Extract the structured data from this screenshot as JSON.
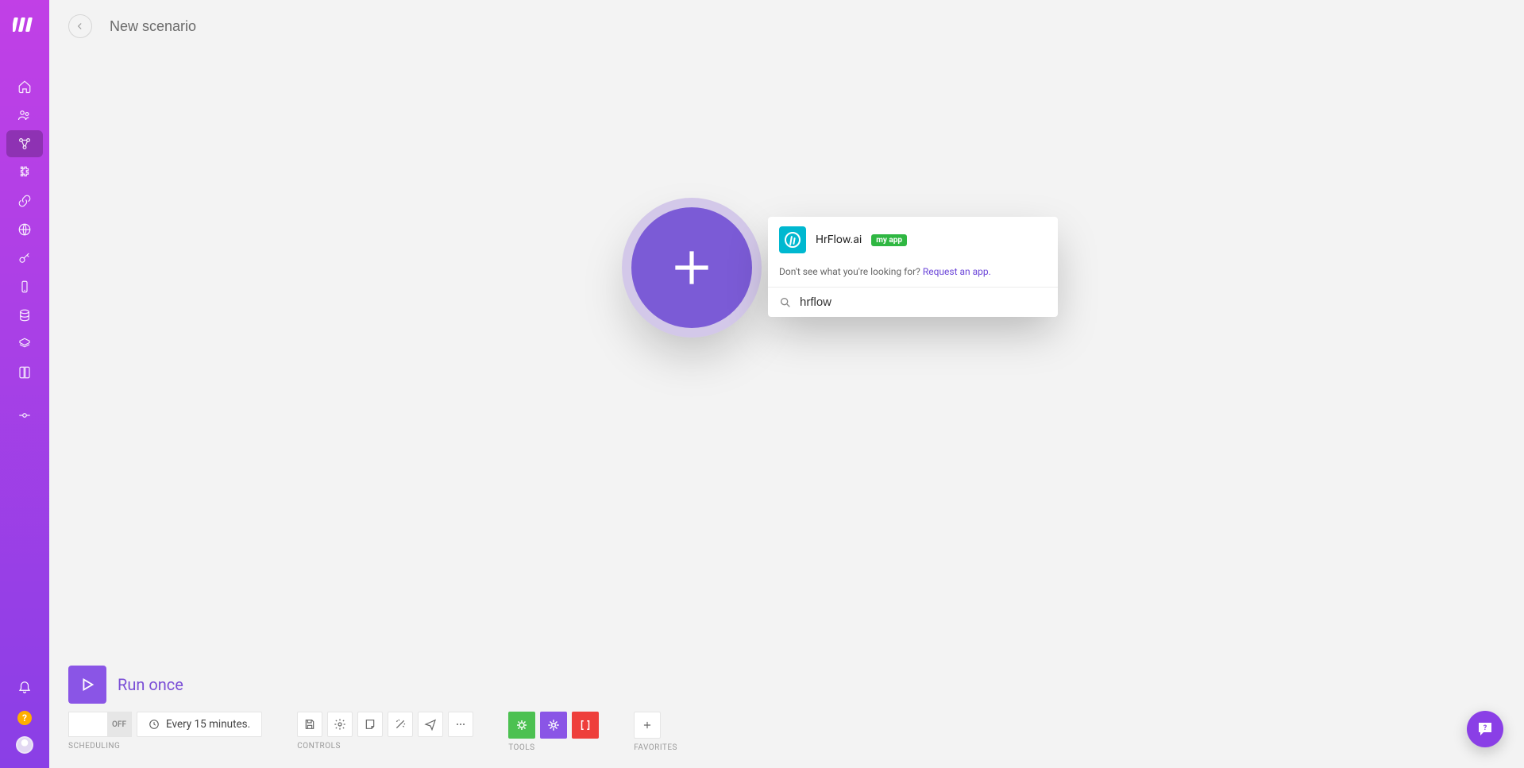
{
  "header": {
    "title": "New scenario"
  },
  "popover": {
    "app_name": "HrFlow.ai",
    "my_app_badge": "my app",
    "hint_prefix": "Don't see what you're looking for? ",
    "hint_link": "Request an app.",
    "search_value": "hrflow"
  },
  "run": {
    "label": "Run once"
  },
  "scheduling": {
    "section_label": "SCHEDULING",
    "toggle_state": "OFF",
    "interval": "Every 15 minutes."
  },
  "controls": {
    "section_label": "CONTROLS"
  },
  "tools": {
    "section_label": "TOOLS"
  },
  "favorites": {
    "section_label": "FAVORITES"
  },
  "help_badge": "?"
}
